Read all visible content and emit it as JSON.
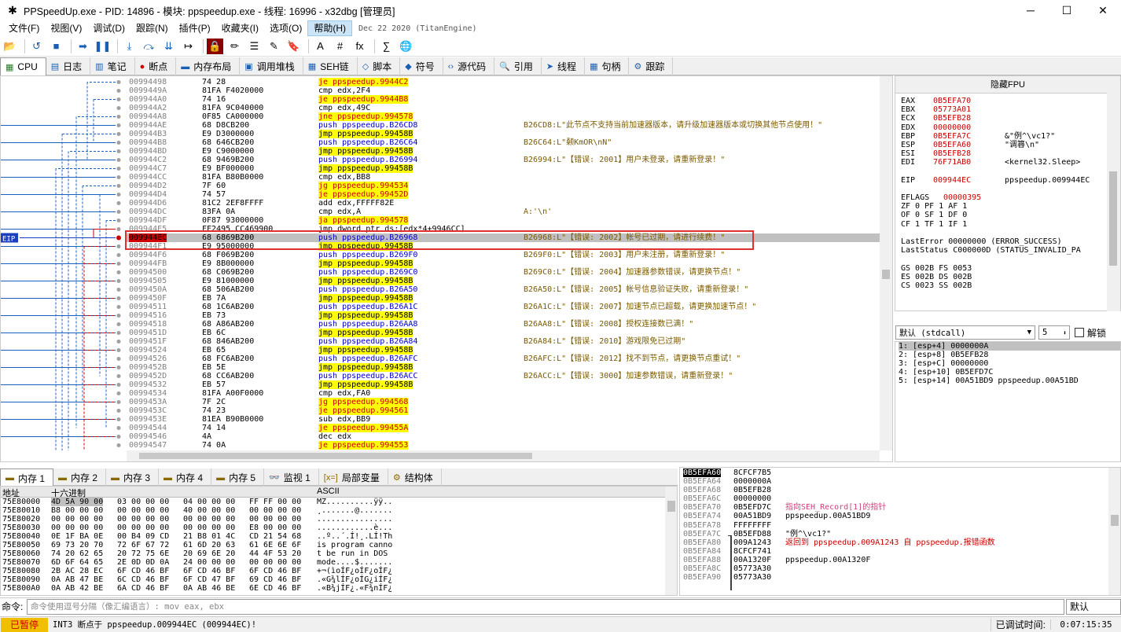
{
  "window": {
    "title": "PPSpeedUp.exe - PID: 14896 - 模块: ppspeedup.exe - 线程: 16996 - x32dbg [管理员]",
    "minimize": "─",
    "maximize": "☐",
    "close": "✕"
  },
  "menu": {
    "items": [
      "文件(F)",
      "视图(V)",
      "调试(D)",
      "跟踪(N)",
      "插件(P)",
      "收藏夹(I)",
      "选项(O)",
      "帮助(H)"
    ],
    "active": "帮助(H)",
    "version": "Dec 22 2020 (TitanEngine)"
  },
  "toolbar": {
    "icons": [
      "open-icon",
      "restart-icon",
      "stop-icon",
      "run-icon",
      "pause-icon",
      "step-into-icon",
      "step-over-icon",
      "trace-into-icon",
      "run-to-user-icon",
      "patch-icon",
      "script-icon",
      "comment-icon",
      "label-icon",
      "bookmark-icon",
      "font-icon",
      "hash-icon",
      "function-icon",
      "calculator-icon",
      "globe-icon"
    ],
    "labels": [
      "📂",
      "↺",
      "■",
      "➡",
      "❚❚",
      "⤓",
      "⤼",
      "⇊",
      "↦",
      "🔒",
      "✏",
      "☰",
      "✎",
      "🔖",
      "A",
      "#",
      "fx",
      "∑",
      "🌐"
    ]
  },
  "tabs": [
    {
      "label": "CPU",
      "icon": "cpu-icon",
      "glyph": "▦"
    },
    {
      "label": "日志",
      "icon": "log-icon",
      "glyph": "▤"
    },
    {
      "label": "笔记",
      "icon": "notes-icon",
      "glyph": "▥"
    },
    {
      "label": "断点",
      "icon": "breakpoint-icon",
      "glyph": "●"
    },
    {
      "label": "内存布局",
      "icon": "memory-map-icon",
      "glyph": "▬"
    },
    {
      "label": "调用堆栈",
      "icon": "callstack-icon",
      "glyph": "▣"
    },
    {
      "label": "SEH链",
      "icon": "seh-icon",
      "glyph": "▦"
    },
    {
      "label": "脚本",
      "icon": "script-tab-icon",
      "glyph": "◇"
    },
    {
      "label": "符号",
      "icon": "symbol-icon",
      "glyph": "◆"
    },
    {
      "label": "源代码",
      "icon": "source-icon",
      "glyph": "‹›"
    },
    {
      "label": "引用",
      "icon": "reference-icon",
      "glyph": "🔍"
    },
    {
      "label": "线程",
      "icon": "thread-icon",
      "glyph": "➤"
    },
    {
      "label": "句柄",
      "icon": "handle-icon",
      "glyph": "▦"
    },
    {
      "label": "跟踪",
      "icon": "trace-icon",
      "glyph": "⚙"
    }
  ],
  "eip_label": "EIP",
  "disasm": [
    {
      "a": "00994498",
      "b": "74 28",
      "d": "je ppspeedup.9944C2",
      "c": ""
    },
    {
      "a": "0099449A",
      "b": "81FA F4020000",
      "d": "cmp edx,2F4",
      "c": ""
    },
    {
      "a": "009944A0",
      "b": "74 16",
      "d": "je ppspeedup.9944B8",
      "c": ""
    },
    {
      "a": "009944A2",
      "b": "81FA 9C040000",
      "d": "cmp edx,49C",
      "c": ""
    },
    {
      "a": "009944A8",
      "b": "0F85 CA000000",
      "d": "jne ppspeedup.994578",
      "c": ""
    },
    {
      "a": "009944AE",
      "b": "68 D8CB200",
      "d": "push ppspeedup.B26CD8",
      "c": "B26CD8:L\"此节点不支持当前加速器版本，请升级加速器版本或切换其他节点使用！\""
    },
    {
      "a": "009944B3",
      "b": "E9 D3000000",
      "d": "jmp ppspeedup.99458B",
      "c": ""
    },
    {
      "a": "009944B8",
      "b": "68 646CB200",
      "d": "push ppspeedup.B26C64",
      "c": "B26C64:L\"颡KmOR\\nN\""
    },
    {
      "a": "009944BD",
      "b": "E9 C9000000",
      "d": "jmp ppspeedup.99458B",
      "c": ""
    },
    {
      "a": "009944C2",
      "b": "68 9469B200",
      "d": "push ppspeedup.B26994",
      "c": "B26994:L\"【错误: 2001】用户未登录，请重新登录！\""
    },
    {
      "a": "009944C7",
      "b": "E9 BF000000",
      "d": "jmp ppspeedup.99458B",
      "c": ""
    },
    {
      "a": "009944CC",
      "b": "81FA B80B0000",
      "d": "cmp edx,BB8",
      "c": ""
    },
    {
      "a": "009944D2",
      "b": "7F 60",
      "d": "jg ppspeedup.994534",
      "c": ""
    },
    {
      "a": "009944D4",
      "b": "74 57",
      "d": "je ppspeedup.99452D",
      "c": ""
    },
    {
      "a": "009944D6",
      "b": "81C2 2EF8FFFF",
      "d": "add edx,FFFFF82E",
      "c": ""
    },
    {
      "a": "009944DC",
      "b": "83FA 0A",
      "d": "cmp edx,A",
      "c": "A:'\\n'"
    },
    {
      "a": "009944DF",
      "b": "0F87 93000000",
      "d": "ja ppspeedup.994578",
      "c": ""
    },
    {
      "a": "009944E5",
      "b": "FF2495 CC469900",
      "d": "jmp dword ptr ds:[edx*4+9946CC]",
      "c": ""
    },
    {
      "a": "009944EC",
      "b": "68 6869B200",
      "d": "push ppspeedup.B26968",
      "c": "B26968:L\"【错误: 2002】帐号已过期，请进行续费！\""
    },
    {
      "a": "009944F1",
      "b": "E9 95000000",
      "d": "jmp ppspeedup.99458B",
      "c": ""
    },
    {
      "a": "009944F6",
      "b": "68 F069B200",
      "d": "push ppspeedup.B269F0",
      "c": "B269F0:L\"【错误: 2003】用户未注册，请重新登录！\""
    },
    {
      "a": "009944FB",
      "b": "E9 8B000000",
      "d": "jmp ppspeedup.99458B",
      "c": ""
    },
    {
      "a": "00994500",
      "b": "68 C069B200",
      "d": "push ppspeedup.B269C0",
      "c": "B269C0:L\"【错误: 2004】加速器参数错误，请更换节点！\""
    },
    {
      "a": "00994505",
      "b": "E9 81000000",
      "d": "jmp ppspeedup.99458B",
      "c": ""
    },
    {
      "a": "0099450A",
      "b": "68 506AB200",
      "d": "push ppspeedup.B26A50",
      "c": "B26A50:L\"【错误: 2005】帐号信息验证失败，请重新登录！\""
    },
    {
      "a": "0099450F",
      "b": "EB 7A",
      "d": "jmp ppspeedup.99458B",
      "c": ""
    },
    {
      "a": "00994511",
      "b": "68 1C6AB200",
      "d": "push ppspeedup.B26A1C",
      "c": "B26A1C:L\"【错误: 2007】加速节点已超载，请更换加速节点！\""
    },
    {
      "a": "00994516",
      "b": "EB 73",
      "d": "jmp ppspeedup.99458B",
      "c": ""
    },
    {
      "a": "00994518",
      "b": "68 A86AB200",
      "d": "push ppspeedup.B26AA8",
      "c": "B26AA8:L\"【错误: 2008】授权连接数已满！\""
    },
    {
      "a": "0099451D",
      "b": "EB 6C",
      "d": "jmp ppspeedup.99458B",
      "c": ""
    },
    {
      "a": "0099451F",
      "b": "68 846AB200",
      "d": "push ppspeedup.B26A84",
      "c": "B26A84:L\"【错误: 2010】游戏限免已过期\""
    },
    {
      "a": "00994524",
      "b": "EB 65",
      "d": "jmp ppspeedup.99458B",
      "c": ""
    },
    {
      "a": "00994526",
      "b": "68 FC6AB200",
      "d": "push ppspeedup.B26AFC",
      "c": "B26AFC:L\"【错误: 2012】找不到节点，请更换节点重试！\""
    },
    {
      "a": "0099452B",
      "b": "EB 5E",
      "d": "jmp ppspeedup.99458B",
      "c": ""
    },
    {
      "a": "0099452D",
      "b": "68 CC6AB200",
      "d": "push ppspeedup.B26ACC",
      "c": "B26ACC:L\"【错误: 3000】加速参数错误，请重新登录！\""
    },
    {
      "a": "00994532",
      "b": "EB 57",
      "d": "jmp ppspeedup.99458B",
      "c": ""
    },
    {
      "a": "00994534",
      "b": "81FA A00F0000",
      "d": "cmp edx,FA0",
      "c": ""
    },
    {
      "a": "0099453A",
      "b": "7F 2C",
      "d": "jg ppspeedup.994568",
      "c": ""
    },
    {
      "a": "0099453C",
      "b": "74 23",
      "d": "je ppspeedup.994561",
      "c": ""
    },
    {
      "a": "0099453E",
      "b": "81EA B90B0000",
      "d": "sub edx,BB9",
      "c": ""
    },
    {
      "a": "00994544",
      "b": "74 14",
      "d": "je ppspeedup.99455A",
      "c": ""
    },
    {
      "a": "00994546",
      "b": "4A",
      "d": "dec edx",
      "c": ""
    },
    {
      "a": "00994547",
      "b": "74 0A",
      "d": "je ppspeedup.994553",
      "c": ""
    }
  ],
  "fpu": {
    "header": "隐藏FPU",
    "regs": [
      {
        "n": "EAX",
        "v": "0B5EFA70",
        "c": ""
      },
      {
        "n": "EBX",
        "v": "05773A01",
        "c": ""
      },
      {
        "n": "ECX",
        "v": "0B5EFB28",
        "c": ""
      },
      {
        "n": "EDX",
        "v": "00000000",
        "c": ""
      },
      {
        "n": "EBP",
        "v": "0B5EFA7C",
        "c": "&\"例^\\vc1?\""
      },
      {
        "n": "ESP",
        "v": "0B5EFA60",
        "c": "\"调簭\\n\""
      },
      {
        "n": "ESI",
        "v": "0B5EFB28",
        "c": ""
      },
      {
        "n": "EDI",
        "v": "76F71AB0",
        "c": "<kernel32.Sleep>"
      }
    ],
    "eip": {
      "n": "EIP",
      "v": "009944EC",
      "c": "ppspeedup.009944EC"
    },
    "eflags": {
      "n": "EFLAGS",
      "v": "00000395"
    },
    "flags": [
      "ZF 0   PF 1   AF 1",
      "OF 0   SF 1   DF 0",
      "CF 1   TF 1   IF 1"
    ],
    "lasterror": "LastError  00000000 (ERROR_SUCCESS)",
    "laststatus": "LastStatus C000000D (STATUS_INVALID_PA",
    "segs": [
      "GS 002B  FS 0053",
      "ES 002B  DS 002B",
      "CS 0023  SS 002B"
    ]
  },
  "callconv": {
    "value": "默认 (stdcall)",
    "count": "5",
    "unlock": "解锁"
  },
  "stackargs": [
    "1: [esp+4] 0000000A",
    "2: [esp+8] 0B5EFB28",
    "3: [esp+C] 00000000",
    "4: [esp+10] 0B5EFD7C",
    "5: [esp+14] 00A51BD9 ppspeedup.00A51BD"
  ],
  "memtabs": [
    "内存 1",
    "内存 2",
    "内存 3",
    "内存 4",
    "内存 5",
    "监视 1",
    "局部变量",
    "结构体"
  ],
  "hex": {
    "h_addr": "地址",
    "h_hex": "十六进制",
    "h_ascii": "ASCII",
    "rows": [
      {
        "a": "75E80000",
        "b": [
          "4D 5A 90 00",
          "03 00 00 00",
          "04 00 00 00",
          "FF FF 00 00"
        ],
        "s": "MZ..........ÿÿ.."
      },
      {
        "a": "75E80010",
        "b": [
          "B8 00 00 00",
          "00 00 00 00",
          "40 00 00 00",
          "00 00 00 00"
        ],
        "s": "¸.......@......."
      },
      {
        "a": "75E80020",
        "b": [
          "00 00 00 00",
          "00 00 00 00",
          "00 00 00 00",
          "00 00 00 00"
        ],
        "s": "................"
      },
      {
        "a": "75E80030",
        "b": [
          "00 00 00 00",
          "00 00 00 00",
          "00 00 00 00",
          "E8 00 00 00"
        ],
        "s": "............è..."
      },
      {
        "a": "75E80040",
        "b": [
          "0E 1F BA 0E",
          "00 B4 09 CD",
          "21 B8 01 4C",
          "CD 21 54 68"
        ],
        "s": "..º..´.Í!¸.LÍ!Th"
      },
      {
        "a": "75E80050",
        "b": [
          "69 73 20 70",
          "72 6F 67 72",
          "61 6D 20 63",
          "61 6E 6E 6F"
        ],
        "s": "is program canno"
      },
      {
        "a": "75E80060",
        "b": [
          "74 20 62 65",
          "20 72 75 6E",
          "20 69 6E 20",
          "44 4F 53 20"
        ],
        "s": "t be run in DOS "
      },
      {
        "a": "75E80070",
        "b": [
          "6D 6F 64 65",
          "2E 0D 0D 0A",
          "24 00 00 00",
          "00 00 00 00"
        ],
        "s": "mode....$......."
      },
      {
        "a": "75E80080",
        "b": [
          "2B AC 28 EC",
          "6F CD 46 BF",
          "6F CD 46 BF",
          "6F CD 46 BF"
        ],
        "s": "+¬(ìoÍF¿oÍF¿oÍF¿"
      },
      {
        "a": "75E80090",
        "b": [
          "0A AB 47 BE",
          "6C CD 46 BF",
          "6F CD 47 BF",
          "69 CD 46 BF"
        ],
        "s": ".«G¾lÍF¿oÍG¿iÍF¿"
      },
      {
        "a": "75E800A0",
        "b": [
          "0A AB 42 BE",
          "6A CD 46 BF",
          "0A AB 46 BE",
          "6E CD 46 BF"
        ],
        "s": ".«B¾jÍF¿.«F¾nÍF¿"
      }
    ]
  },
  "stack": [
    {
      "a": "0B5EFA60",
      "v": "8CFCF7B5",
      "c": ""
    },
    {
      "a": "0B5EFA64",
      "v": "0000000A",
      "c": ""
    },
    {
      "a": "0B5EFA68",
      "v": "0B5EFB28",
      "c": ""
    },
    {
      "a": "0B5EFA6C",
      "v": "00000000",
      "c": ""
    },
    {
      "a": "0B5EFA70",
      "v": "0B5EFD7C",
      "c": "指向SEH_Record[1]的指针"
    },
    {
      "a": "0B5EFA74",
      "v": "00A51BD9",
      "c": "ppspeedup.00A51BD9"
    },
    {
      "a": "0B5EFA78",
      "v": "FFFFFFFF",
      "c": ""
    },
    {
      "a": "0B5EFA7C",
      "v": "0B5EFD88",
      "c": "\"例^\\vc1?\""
    },
    {
      "a": "0B5EFA80",
      "v": "009A1243",
      "c": "返回到 ppspeedup.009A1243 自 ppspeedup.报错函数"
    },
    {
      "a": "0B5EFA84",
      "v": "8CFCF741",
      "c": ""
    },
    {
      "a": "0B5EFA88",
      "v": "00A1320F",
      "c": "ppspeedup.00A1320F"
    },
    {
      "a": "0B5EFA8C",
      "v": "05773A30",
      "c": ""
    },
    {
      "a": "0B5EFA90",
      "v": "05773A30",
      "c": ""
    }
  ],
  "command": {
    "label": "命令:",
    "placeholder": "命令使用逗号分隔（像汇编语言）: mov eax, ebx",
    "mode": "默认"
  },
  "status": {
    "state": "已暂停",
    "message": "INT3 断点于 ppspeedup.009944EC (009944EC)!",
    "time_label": "已调试时间:",
    "time": "0:07:15:35"
  }
}
